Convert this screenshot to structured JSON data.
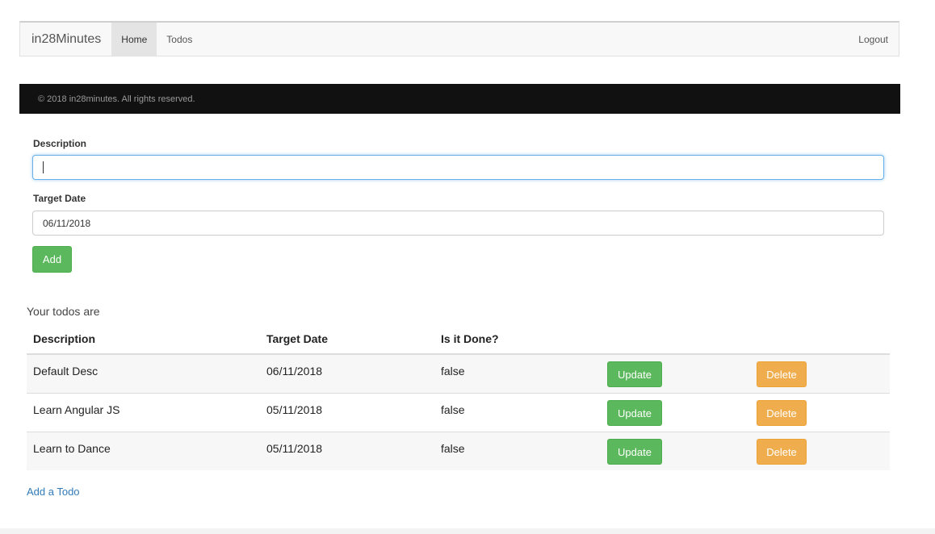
{
  "navbar": {
    "brand": "in28Minutes",
    "items": [
      {
        "label": "Home",
        "active": true
      },
      {
        "label": "Todos",
        "active": false
      }
    ],
    "logout": "Logout"
  },
  "footer": {
    "copyright": "© 2018 in28minutes. All rights reserved."
  },
  "form": {
    "description_label": "Description",
    "description_value": "",
    "target_date_label": "Target Date",
    "target_date_value": "06/11/2018",
    "add_button": "Add"
  },
  "todos": {
    "caption": "Your todos are",
    "columns": [
      "Description",
      "Target Date",
      "Is it Done?"
    ],
    "update_label": "Update",
    "delete_label": "Delete",
    "rows": [
      {
        "description": "Default Desc",
        "target_date": "06/11/2018",
        "done": "false"
      },
      {
        "description": "Learn Angular JS",
        "target_date": "05/11/2018",
        "done": "false"
      },
      {
        "description": "Learn to Dance",
        "target_date": "05/11/2018",
        "done": "false"
      }
    ]
  },
  "add_todo_link": "Add a Todo",
  "colors": {
    "success": "#5cb85c",
    "warning": "#f0ad4e",
    "link": "#337ab7",
    "footer_bg": "#111111"
  }
}
